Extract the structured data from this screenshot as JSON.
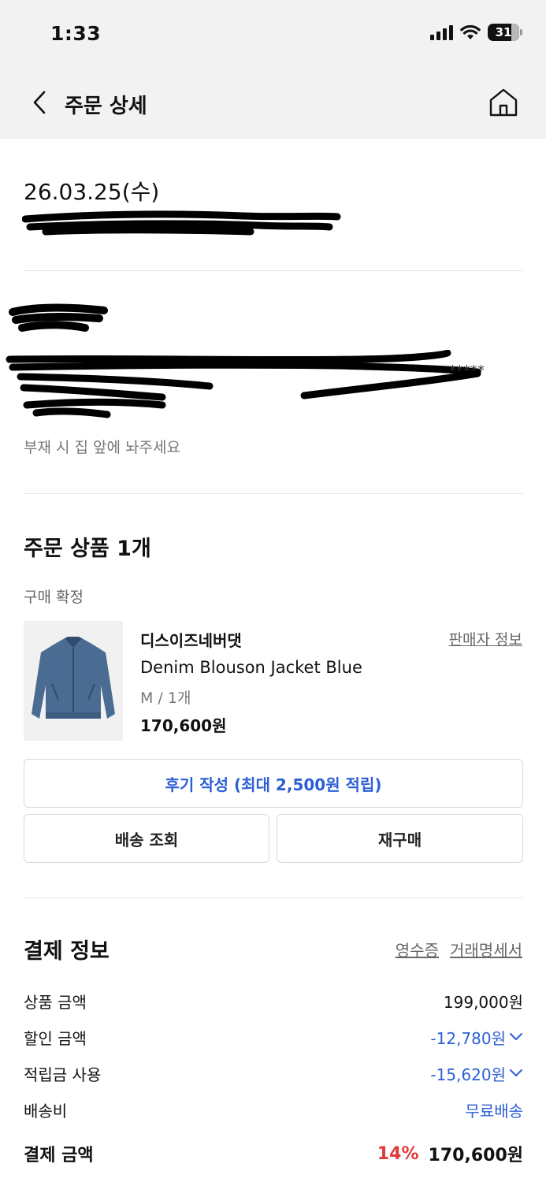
{
  "status_bar": {
    "time": "1:33",
    "battery": "31"
  },
  "nav": {
    "title": "주문 상세"
  },
  "order": {
    "date": "26.03.25(수)"
  },
  "shipping": {
    "masked_tail": "*****",
    "memo": "부재 시 집 앞에 놔주세요"
  },
  "products": {
    "title": "주문 상품 1개",
    "status": "구매 확정",
    "item": {
      "brand": "디스이즈네버댓",
      "seller_link": "판매자 정보",
      "name": "Denim Blouson Jacket Blue",
      "option": "M / 1개",
      "price": "170,600원"
    },
    "review_button": "후기 작성 (최대 2,500원 적립)",
    "track_button": "배송 조회",
    "rebuy_button": "재구매"
  },
  "payment": {
    "title": "결제 정보",
    "receipt_link": "영수증",
    "statement_link": "거래명세서",
    "rows": [
      {
        "label": "상품 금액",
        "value": "199,000원"
      },
      {
        "label": "할인 금액",
        "value": "-12,780원"
      },
      {
        "label": "적립금 사용",
        "value": "-15,620원"
      },
      {
        "label": "배송비",
        "value": "무료배송"
      }
    ],
    "total": {
      "label": "결제 금액",
      "rate": "14%",
      "value": "170,600원"
    }
  },
  "icons": {
    "back": "chevron-left-icon",
    "home": "home-icon",
    "expand": "chevron-down-icon"
  },
  "colors": {
    "accent_blue": "#2c5fd6",
    "discount_red": "#e23a3a",
    "header_bg": "#f2f2f2"
  }
}
